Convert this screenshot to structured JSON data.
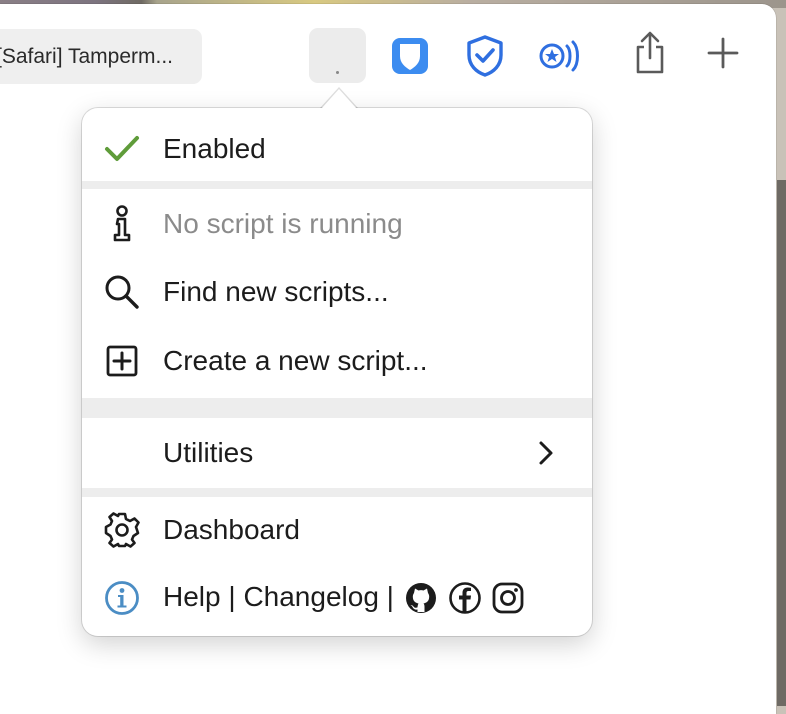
{
  "tab": {
    "title": "[Safari] Tamperm..."
  },
  "toolbar": {
    "icons": [
      "tampermonkey-icon",
      "bitwarden-icon",
      "adguard-shield-icon",
      "starred-sound-icon",
      "share-icon",
      "new-tab-plus-icon"
    ]
  },
  "menu": {
    "enabled_label": "Enabled",
    "no_script_label": "No script is running",
    "find_label": "Find new scripts...",
    "create_label": "Create a new script...",
    "utilities_label": "Utilities",
    "dashboard_label": "Dashboard",
    "help_label": "Help",
    "pipe1": "|",
    "changelog_label": "Changelog",
    "pipe2": "|"
  },
  "colors": {
    "check": "#5f9c3a",
    "info": "#4b8dc4",
    "bitwarden": "#3c8cf0",
    "shield": "#2f6fe0",
    "separator": "#ededed"
  }
}
